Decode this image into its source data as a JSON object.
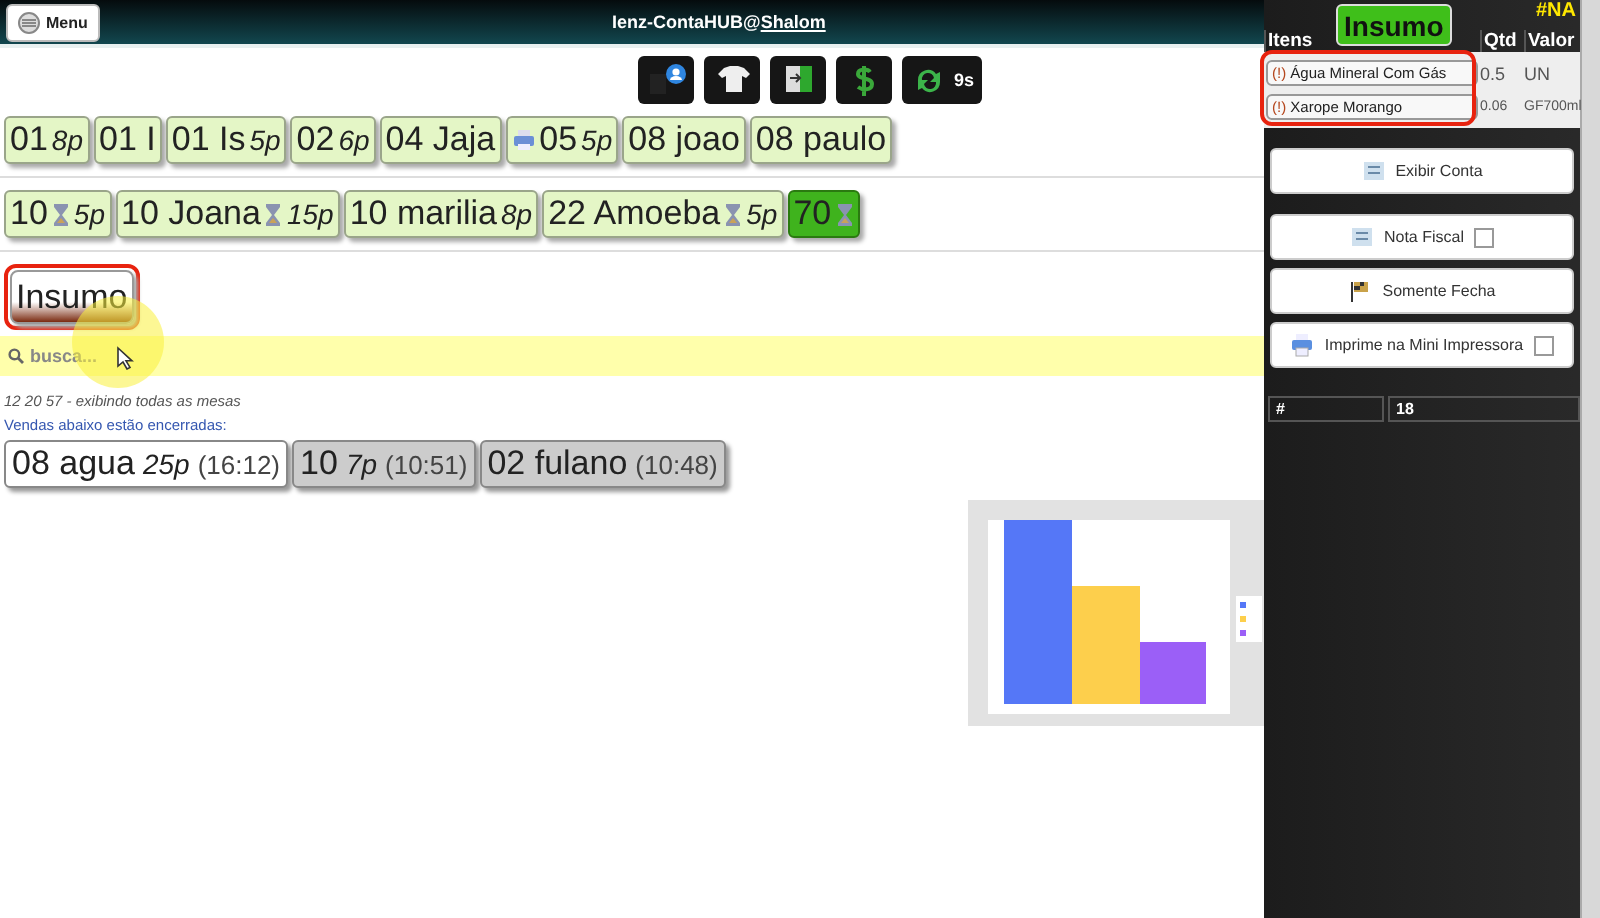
{
  "header": {
    "menu_button": "Menu",
    "title": "Ienz-ContaHUB@",
    "title_link": "Shalom"
  },
  "toolbar": [
    {
      "kind": "user"
    },
    {
      "kind": "shirt"
    },
    {
      "kind": "exit"
    },
    {
      "kind": "money"
    },
    {
      "kind": "refresh",
      "label": "9s"
    }
  ],
  "open_tables": [
    [
      {
        "label": "01",
        "people": "8p",
        "hourglass": false,
        "printer": false,
        "selected": false
      },
      {
        "label": "01 I",
        "hourglass": false,
        "printer": false,
        "selected": false
      },
      {
        "label": "01 Is",
        "people": "5p",
        "hourglass": false,
        "printer": false,
        "selected": false
      },
      {
        "label": "02",
        "people": "6p",
        "hourglass": false,
        "printer": false,
        "selected": false
      },
      {
        "label": "04 Jaja",
        "hourglass": false,
        "printer": false,
        "selected": false
      },
      {
        "label": "05",
        "people": "5p",
        "hourglass": false,
        "printer": true,
        "selected": false
      },
      {
        "label": "08 joao",
        "hourglass": false,
        "printer": false,
        "selected": false
      },
      {
        "label": "08 paulo",
        "hourglass": false,
        "printer": false,
        "selected": false
      }
    ],
    [
      {
        "label": "10",
        "people": "5p",
        "hourglass": true,
        "printer": false,
        "selected": false
      },
      {
        "label": "10 Joana",
        "people": "15p",
        "hourglass": true,
        "printer": false,
        "selected": false
      },
      {
        "label": "10 marilia",
        "people": "8p",
        "hourglass": false,
        "printer": false,
        "selected": false
      },
      {
        "label": "22 Amoeba",
        "people": "5p",
        "hourglass": true,
        "printer": false,
        "selected": false
      },
      {
        "label": "70",
        "hourglass": true,
        "printer": false,
        "selected": true
      }
    ]
  ],
  "category_button": "Insumo",
  "search": {
    "placeholder": "busca..."
  },
  "status": "12 20 57 - exibindo todas as mesas",
  "closed_heading": "Vendas abaixo estão encerradas:",
  "closed_tables": [
    {
      "label": "08 agua",
      "people": "25p",
      "time": "(16:12)",
      "highlighted": true
    },
    {
      "label": "10",
      "people": "7p",
      "time": "(10:51)",
      "highlighted": false
    },
    {
      "label": "02 fulano",
      "time": "(10:48)",
      "highlighted": false
    }
  ],
  "side": {
    "tag": "#NA",
    "category": "Insumo",
    "columns": [
      "Itens",
      "Qtd",
      "Valor"
    ],
    "items": [
      {
        "mark": "(!)",
        "name": "Água Mineral Com Gás",
        "qty": "0.5",
        "value": "UN"
      },
      {
        "mark": "(!)",
        "name": "Xarope Morango",
        "qty": "0.06",
        "value": "GF700ml"
      }
    ],
    "actions": [
      {
        "kind": "bill",
        "label": "Exibir Conta"
      },
      {
        "kind": "invoice",
        "label": "Nota Fiscal",
        "checkbox": false
      },
      {
        "kind": "flag",
        "label": "Somente Fecha"
      },
      {
        "kind": "printer",
        "label": "Imprime na Mini Impressora",
        "checkbox": false
      }
    ],
    "footer": [
      "#",
      "18"
    ]
  }
}
